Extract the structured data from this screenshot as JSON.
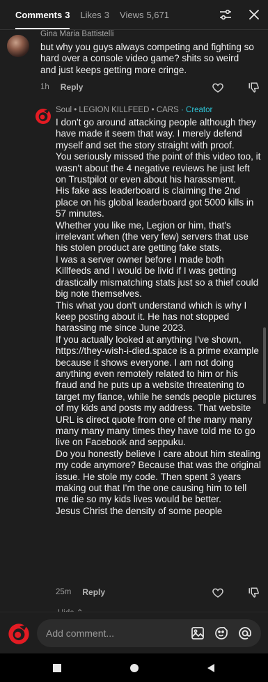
{
  "header": {
    "tabs": [
      {
        "label": "Comments",
        "count": "3",
        "active": true
      },
      {
        "label": "Likes",
        "count": "3",
        "active": false
      },
      {
        "label": "Views",
        "count": "5,671",
        "active": false
      }
    ],
    "icons": [
      "sliders-icon",
      "close-icon"
    ]
  },
  "comments": [
    {
      "author": "Gina Maria Battistelli",
      "text": [
        "but why you guys always competing and fighting so hard over a console video game? shits so weird and just keeps getting more cringe."
      ],
      "time": "1h",
      "reply_label": "Reply"
    },
    {
      "author": "Soul • LEGION KILLFEED • CARS",
      "badge": "· Creator",
      "text": [
        "I don't go around attacking people although they have made it seem that way. I merely defend myself and set the story straight with proof.",
        "You seriously missed the point of this video too, it wasn't about the 4 negative reviews he just left on Trustpilot or even about his harassment.",
        "His fake ass leaderboard is claiming the 2nd place on his global leaderboard got 5000 kills in 57 minutes.",
        "Whether you like me, Legion or him, that's irrelevant when (the very few) servers that use his stolen product are getting fake stats.",
        "I was a server owner before I made both Killfeeds and I would be livid if I was getting drastically mismatching stats just so a thief could big note themselves.",
        "This what you don't understand which is why I keep posting about it. He has not stopped harassing me since June 2023.",
        "If you actually looked at anything I've shown, https://they-wish-i-died.space is a prime example because it shows everyone. I am not doing anything even remotely related to him or his fraud and he puts up a website threatening to target my fiance, while he sends people pictures of my kids and posts my address. That website URL is direct quote from one of the many many many many many times they have told me to go live on Facebook and seppuku.",
        "Do you honestly believe I care about him stealing my code anymore? Because that was the original issue. He stole my code. Then spent 3 years making out that I'm the one causing him to tell me die so my kids lives would be better.",
        "Jesus Christ the density of some people"
      ],
      "time": "25m",
      "reply_label": "Reply"
    }
  ],
  "hide_label": "Hide ⌃",
  "composer": {
    "placeholder": "Add comment...",
    "icons": [
      "image-icon",
      "sticker-icon",
      "mention-icon"
    ]
  },
  "system_nav": [
    "recents-button",
    "home-button",
    "back-button"
  ],
  "colors": {
    "background": "#1e1e1e",
    "creator_badge": "#2ec4d6",
    "logo_red": "#e31b23"
  }
}
